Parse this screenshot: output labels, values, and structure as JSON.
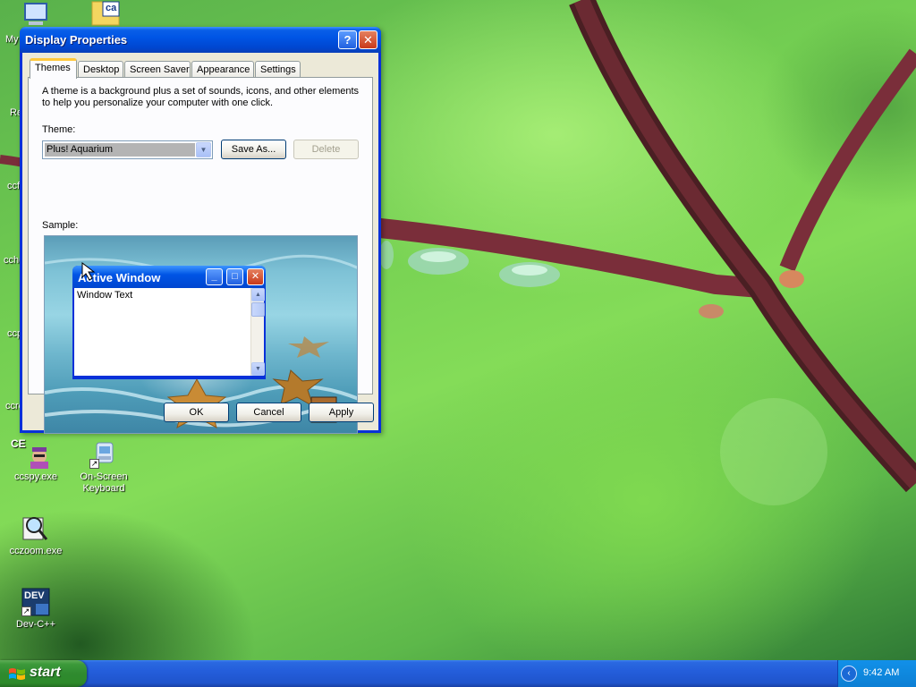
{
  "desktop": {
    "icons": [
      {
        "label": "ccspy.exe"
      },
      {
        "label": "On-Screen Keyboard"
      },
      {
        "label": "cczoom.exe"
      },
      {
        "label": "Dev-C++"
      }
    ],
    "partial_labels": [
      "My",
      "Re",
      "ccf",
      "cche",
      "ccp",
      "ccre"
    ],
    "ce_label": "CE",
    "ca_label": "ca",
    "dev_label": "DEV"
  },
  "window": {
    "title": "Display Properties",
    "help_glyph": "?",
    "close_glyph": "✕",
    "tabs": [
      {
        "label": "Themes",
        "active": true
      },
      {
        "label": "Desktop",
        "active": false
      },
      {
        "label": "Screen Saver",
        "active": false
      },
      {
        "label": "Appearance",
        "active": false
      },
      {
        "label": "Settings",
        "active": false
      }
    ],
    "intro": "A theme is a background plus a set of sounds, icons, and other elements to help you personalize your computer with one click.",
    "theme_label": "Theme:",
    "theme_value": "Plus! Aquarium",
    "save_as": "Save As...",
    "delete": "Delete",
    "sample_label": "Sample:",
    "sample": {
      "active_window_title": "Active Window",
      "window_text": "Window Text"
    },
    "ok": "OK",
    "cancel": "Cancel",
    "apply": "Apply"
  },
  "taskbar": {
    "start_label": "start",
    "clock": "9:42 AM",
    "tray_chevron": "‹"
  },
  "colors": {
    "titlebar_blue": "#0055e5",
    "start_green": "#2f8a2f",
    "taskbar_blue": "#245edb",
    "dialog_bg": "#ece9d8",
    "active_tab_accent": "#ffc83c"
  }
}
